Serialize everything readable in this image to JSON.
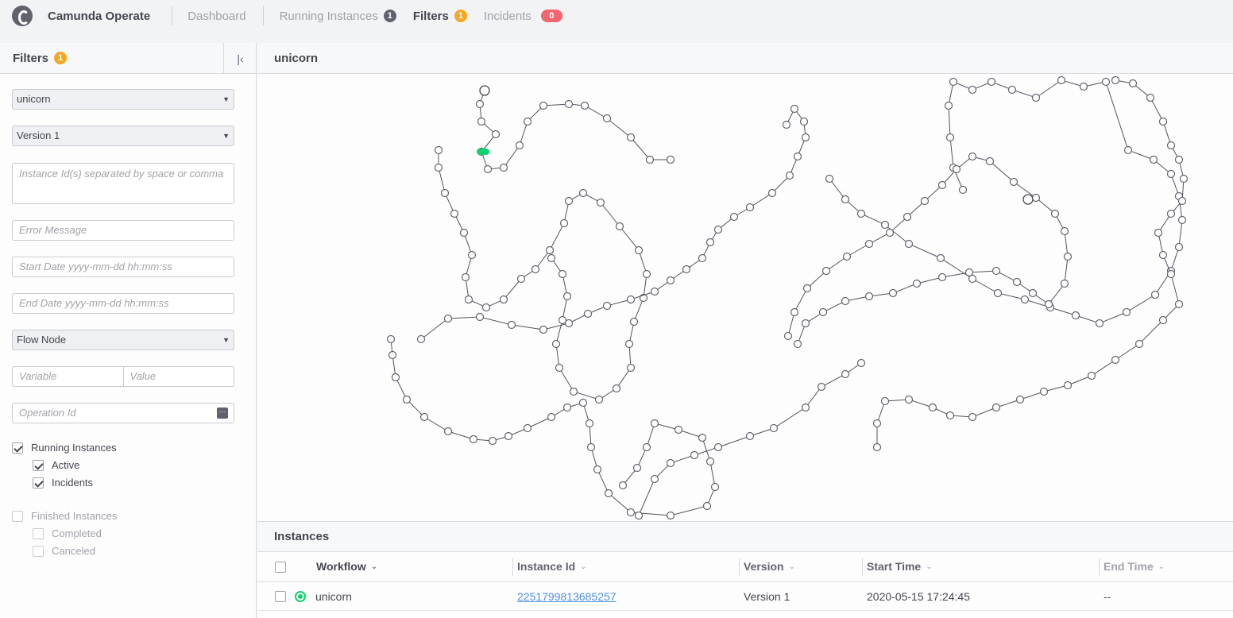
{
  "header": {
    "app_name": "Camunda Operate",
    "nav": [
      {
        "label": "Dashboard"
      },
      {
        "label": "Running Instances",
        "count": "1"
      },
      {
        "label": "Filters",
        "count": "1"
      },
      {
        "label": "Incidents",
        "count": "0"
      }
    ]
  },
  "filters": {
    "title": "Filters",
    "count": "1",
    "workflow_select": "unicorn",
    "version_select": "Version 1",
    "instance_ids_placeholder": "Instance Id(s) separated by space or comma",
    "error_message_placeholder": "Error Message",
    "start_date_placeholder": "Start Date yyyy-mm-dd hh:mm:ss",
    "end_date_placeholder": "End Date yyyy-mm-dd hh:mm:ss",
    "flow_node_select": "Flow Node",
    "variable_placeholder": "Variable",
    "value_placeholder": "Value",
    "operation_id_placeholder": "Operation Id",
    "running_label": "Running Instances",
    "active_label": "Active",
    "incidents_label": "Incidents",
    "finished_label": "Finished Instances",
    "completed_label": "Completed",
    "canceled_label": "Canceled"
  },
  "diagram": {
    "title": "unicorn"
  },
  "instances": {
    "title": "Instances",
    "columns": [
      "Workflow",
      "Instance Id",
      "Version",
      "Start Time",
      "End Time"
    ],
    "rows": [
      {
        "workflow": "unicorn",
        "instance_id": "2251799813685257",
        "version": "Version 1",
        "start_time": "2020-05-15 17:24:45",
        "end_time": "--"
      }
    ]
  },
  "colors": {
    "accent_orange": "#f5a623",
    "incident_red": "#f26470",
    "active_green": "#10d070",
    "link_blue": "#4d90e5"
  }
}
